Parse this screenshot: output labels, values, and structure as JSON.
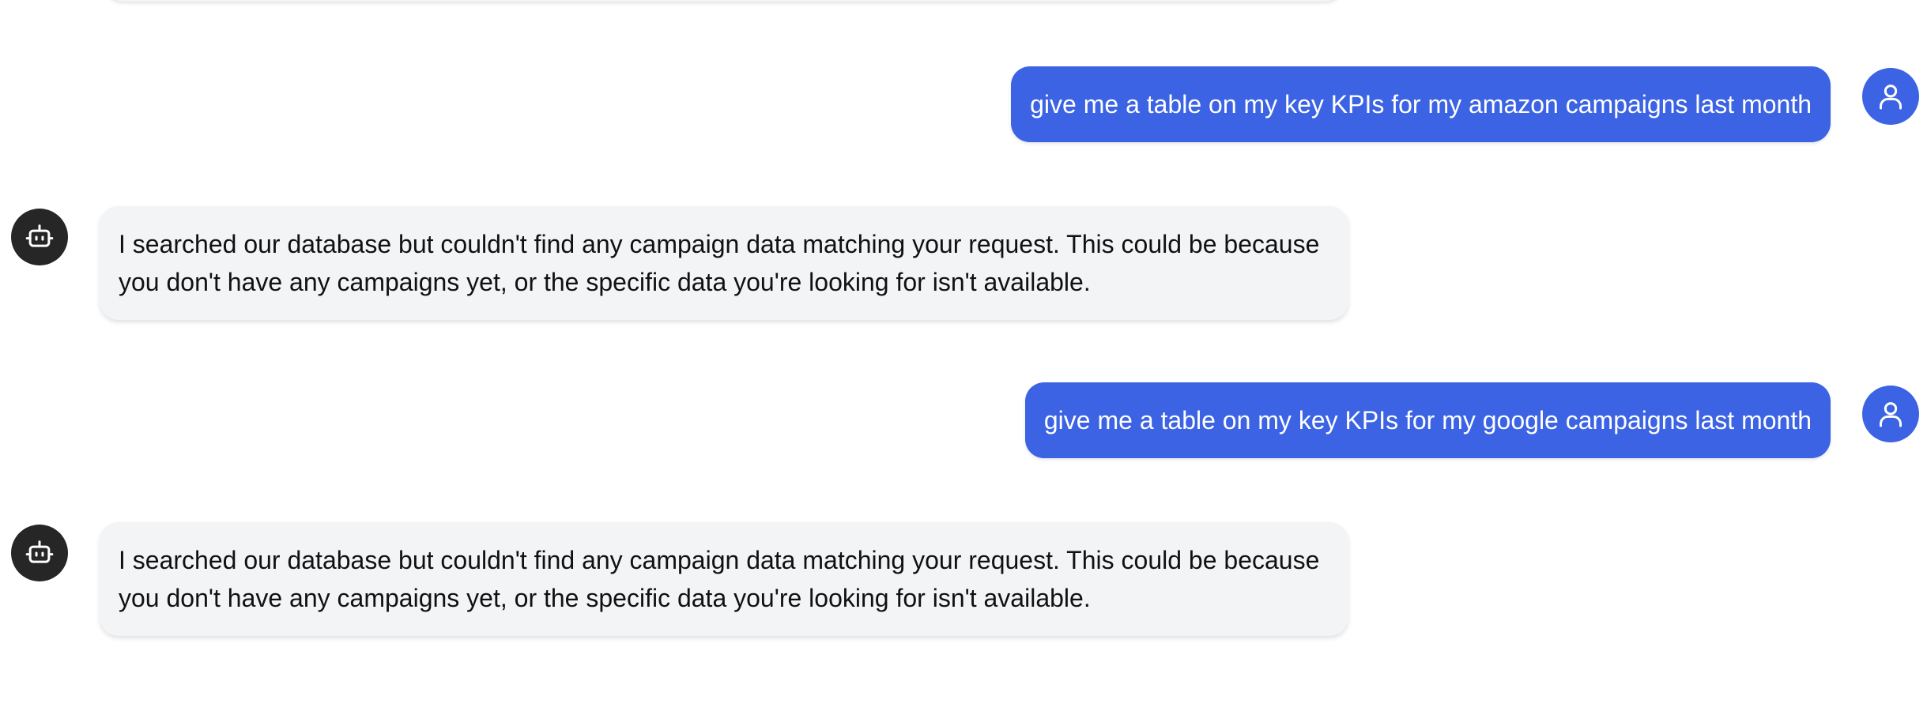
{
  "conversation": {
    "messages": [
      {
        "role": "user",
        "text": "give me a table on my key KPIs for my amazon campaigns last month",
        "avatar_icon": "user-icon"
      },
      {
        "role": "assistant",
        "text": "I searched our database but couldn't find any campaign data matching your request. This could be because you don't have any campaigns yet, or the specific data you're looking for isn't available.",
        "avatar_icon": "bot-icon"
      },
      {
        "role": "user",
        "text": "give me a table on my key KPIs for my google campaigns last month",
        "avatar_icon": "user-icon"
      },
      {
        "role": "assistant",
        "text": "I searched our database but couldn't find any campaign data matching your request. This could be because you don't have any campaigns yet, or the specific data you're looking for isn't available.",
        "avatar_icon": "bot-icon"
      }
    ]
  },
  "colors": {
    "user_bubble": "#3b63e3",
    "assistant_bubble": "#f3f4f6",
    "bot_avatar": "#262626",
    "user_text": "#ffffff",
    "assistant_text": "#111111"
  }
}
